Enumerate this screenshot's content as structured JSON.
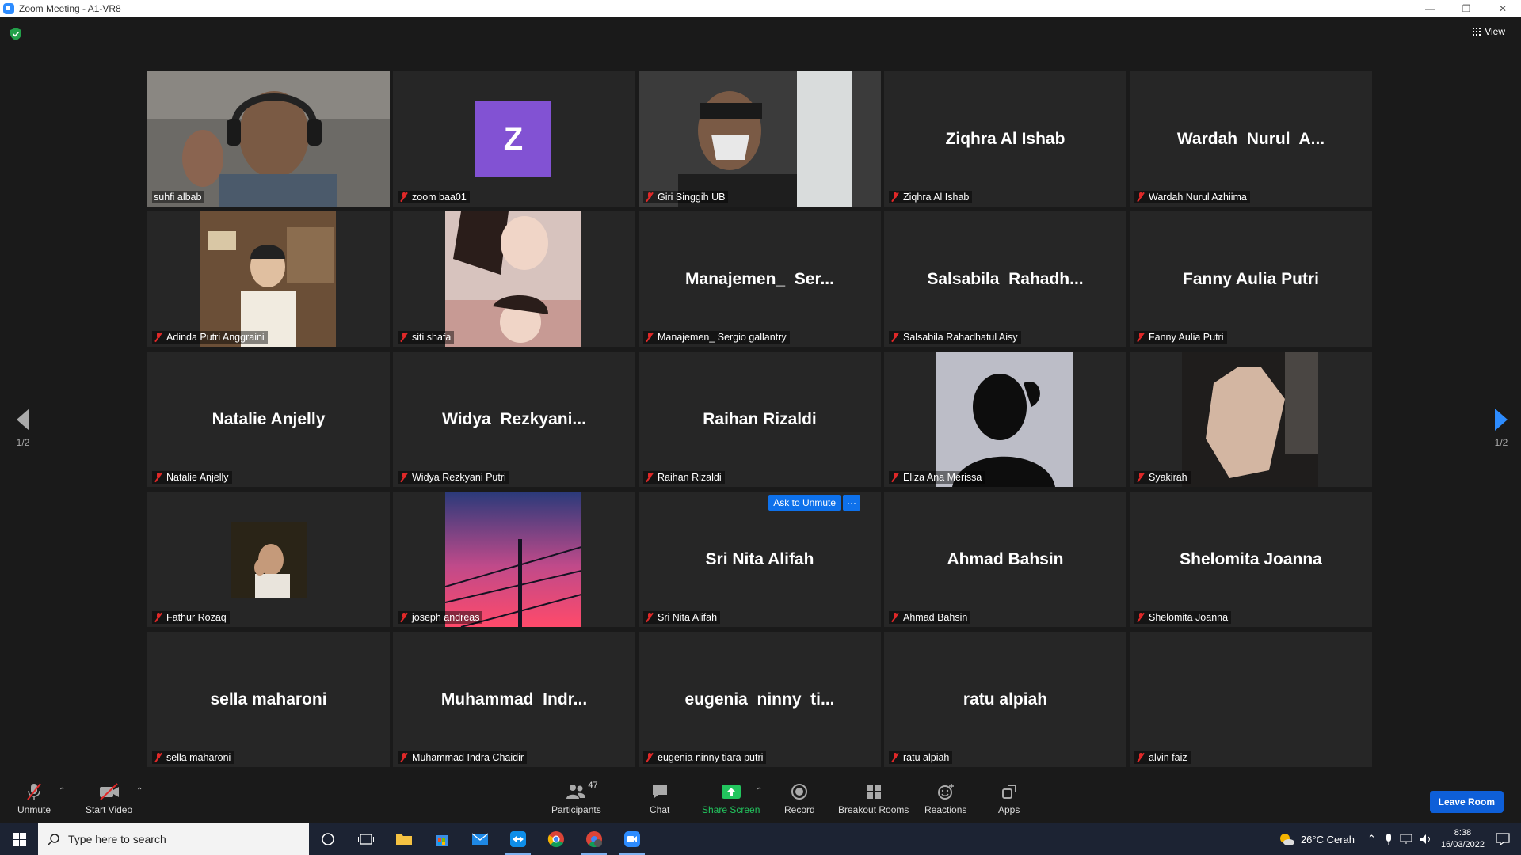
{
  "window": {
    "title": "Zoom Meeting - A1-VR8",
    "minimize": "—",
    "restore": "❐",
    "close": "✕"
  },
  "view_button": {
    "label": "View"
  },
  "pagination": {
    "left": "1/2",
    "right": "1/2"
  },
  "tiles": [
    {
      "display": "",
      "label": "suhfi albab",
      "muted": false,
      "video": "face1",
      "active": true
    },
    {
      "display": "",
      "label": "zoom baa01",
      "muted": true,
      "avatar": "Z"
    },
    {
      "display": "",
      "label": "Giri Singgih UB",
      "muted": true,
      "video": "face2"
    },
    {
      "display": "Ziqhra Al Ishab",
      "label": "Ziqhra Al Ishab",
      "muted": true
    },
    {
      "display": "Wardah  Nurul  A...",
      "label": "Wardah Nurul Azhiima",
      "muted": true
    },
    {
      "display": "",
      "label": "Adinda Putri Anggraini",
      "muted": true,
      "video": "room"
    },
    {
      "display": "",
      "label": "siti shafa",
      "muted": true,
      "video": "girl"
    },
    {
      "display": "Manajemen_  Ser...",
      "label": "Manajemen_ Sergio gallantry",
      "muted": true
    },
    {
      "display": "Salsabila  Rahadh...",
      "label": "Salsabila Rahadhatul Aisy",
      "muted": true
    },
    {
      "display": "Fanny Aulia Putri",
      "label": "Fanny Aulia Putri",
      "muted": true
    },
    {
      "display": "Natalie Anjelly",
      "label": "Natalie Anjelly",
      "muted": true
    },
    {
      "display": "Widya  Rezkyani...",
      "label": "Widya Rezkyani Putri",
      "muted": true
    },
    {
      "display": "Raihan Rizaldi",
      "label": "Raihan Rizaldi",
      "muted": true
    },
    {
      "display": "",
      "label": "Eliza Ana Merissa",
      "muted": true,
      "video": "silhouette"
    },
    {
      "display": "",
      "label": "Syakirah",
      "muted": true,
      "video": "hand"
    },
    {
      "display": "",
      "label": "Fathur Rozaq",
      "muted": true,
      "video": "small"
    },
    {
      "display": "",
      "label": "joseph andreas",
      "muted": true,
      "video": "sunset"
    },
    {
      "display": "Sri Nita Alifah",
      "label": "Sri Nita Alifah",
      "muted": true,
      "ask_unmute": true
    },
    {
      "display": "Ahmad Bahsin",
      "label": "Ahmad Bahsin",
      "muted": true
    },
    {
      "display": "Shelomita Joanna",
      "label": "Shelomita Joanna",
      "muted": true
    },
    {
      "display": "sella maharoni",
      "label": "sella maharoni",
      "muted": true
    },
    {
      "display": "Muhammad  Indr...",
      "label": "Muhammad Indra Chaidir",
      "muted": true
    },
    {
      "display": "eugenia  ninny  ti...",
      "label": "eugenia ninny tiara putri",
      "muted": true
    },
    {
      "display": "ratu alpiah",
      "label": "ratu alpiah",
      "muted": true
    },
    {
      "display": "",
      "label": "alvin faiz",
      "muted": true
    }
  ],
  "ask_unmute": {
    "label": "Ask to Unmute",
    "more": "···"
  },
  "toolbar": {
    "unmute": "Unmute",
    "start_video": "Start Video",
    "participants": "Participants",
    "participants_count": "47",
    "chat": "Chat",
    "share_screen": "Share Screen",
    "record": "Record",
    "breakout_rooms": "Breakout Rooms",
    "reactions": "Reactions",
    "apps": "Apps",
    "leave": "Leave Room"
  },
  "taskbar": {
    "search_placeholder": "Type here to search",
    "weather": "26°C  Cerah",
    "time": "8:38",
    "date": "16/03/2022"
  },
  "colors": {
    "accent": "#2d8cff",
    "active_speaker": "#e8f35a",
    "muted": "#e02828",
    "share_green": "#22c55e",
    "avatar_purple": "#8252d3"
  }
}
